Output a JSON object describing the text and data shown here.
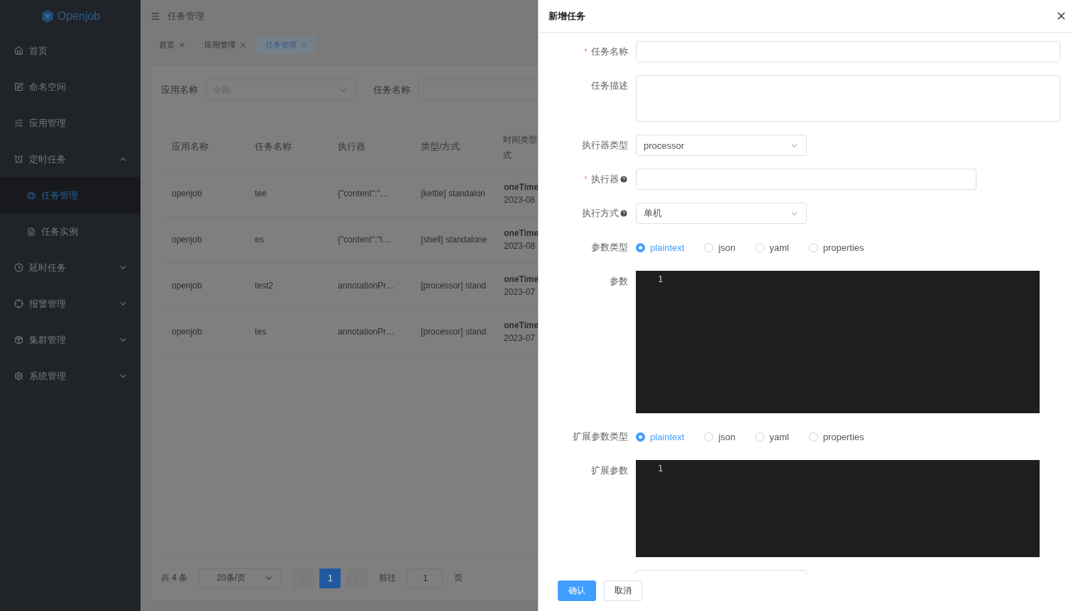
{
  "sidebar": {
    "logo": "Openjob",
    "items": [
      {
        "label": "首页",
        "selected": false
      },
      {
        "label": "命名空间",
        "selected": false
      },
      {
        "label": "应用管理",
        "selected": false
      },
      {
        "label": "定时任务",
        "selected": false,
        "expanded": true,
        "children": [
          {
            "label": "任务管理",
            "selected": true
          },
          {
            "label": "任务实例",
            "selected": false
          }
        ]
      },
      {
        "label": "延时任务",
        "selected": false,
        "expanded": false
      },
      {
        "label": "报警管理",
        "selected": false,
        "expanded": false
      },
      {
        "label": "集群管理",
        "selected": false,
        "expanded": false
      },
      {
        "label": "系统管理",
        "selected": false,
        "expanded": false
      }
    ]
  },
  "header": {
    "title": "任务管理"
  },
  "tabs": [
    {
      "label": "首页",
      "selected": false
    },
    {
      "label": "应用管理",
      "selected": false
    },
    {
      "label": "任务管理",
      "selected": true
    }
  ],
  "filters": [
    {
      "label": "应用名称",
      "kind": "select",
      "placeholder": "全部"
    },
    {
      "label": "任务名称",
      "kind": "input"
    }
  ],
  "table": {
    "columns": [
      "应用名称",
      "任务名称",
      "执行器",
      "类型/方式",
      "时间类型式"
    ],
    "rows": [
      {
        "cells": [
          "openjob",
          "tee",
          "{\"content\":\"…",
          "[kettle] standalon"
        ],
        "time": [
          "oneTime",
          "2023-08"
        ]
      },
      {
        "cells": [
          "openjob",
          "es",
          "{\"content\":\"t…",
          "[shell] standalone"
        ],
        "time": [
          "oneTime",
          "2023-08"
        ]
      },
      {
        "cells": [
          "openjob",
          "test2",
          "annotationPr…",
          "[processor] stand"
        ],
        "time": [
          "oneTime",
          "2023-07"
        ]
      },
      {
        "cells": [
          "openjob",
          "tes",
          "annotationPr…",
          "[processor] stand"
        ],
        "time": [
          "oneTime",
          "2023-07"
        ]
      }
    ]
  },
  "pagination": {
    "total": "共 4 条",
    "page_size": "20条/页",
    "pages": [
      {
        "label": "1",
        "selected": true
      }
    ],
    "goto_label": "前往",
    "goto_value": "1",
    "goto_suffix": "页"
  },
  "drawer": {
    "title": "新增任务",
    "items": [
      {
        "kind": "input",
        "label": "任务名称",
        "required": true
      },
      {
        "kind": "textarea",
        "label": "任务描述"
      },
      {
        "kind": "select",
        "label": "执行器类型",
        "value": "processor"
      },
      {
        "kind": "input-medium",
        "label": "执行器",
        "required": true,
        "help": true
      },
      {
        "kind": "select",
        "label": "执行方式",
        "help": true,
        "value": "单机"
      },
      {
        "kind": "radio",
        "label": "参数类型",
        "options": [
          {
            "label": "plaintext",
            "selected": true
          },
          {
            "label": "json",
            "selected": false
          },
          {
            "label": "yaml",
            "selected": false
          },
          {
            "label": "properties",
            "selected": false
          }
        ]
      },
      {
        "kind": "editor",
        "label": "参数",
        "line": "1"
      },
      {
        "kind": "radio",
        "label": "扩展参数类型",
        "options": [
          {
            "label": "plaintext",
            "selected": true
          },
          {
            "label": "json",
            "selected": false
          },
          {
            "label": "yaml",
            "selected": false
          },
          {
            "label": "properties",
            "selected": false
          }
        ]
      },
      {
        "kind": "editor-short",
        "label": "扩展参数",
        "line": "1"
      },
      {
        "kind": "select"
      }
    ],
    "buttons": [
      {
        "label": "确认",
        "kind": "primary"
      },
      {
        "label": "取消",
        "kind": "default"
      }
    ]
  }
}
